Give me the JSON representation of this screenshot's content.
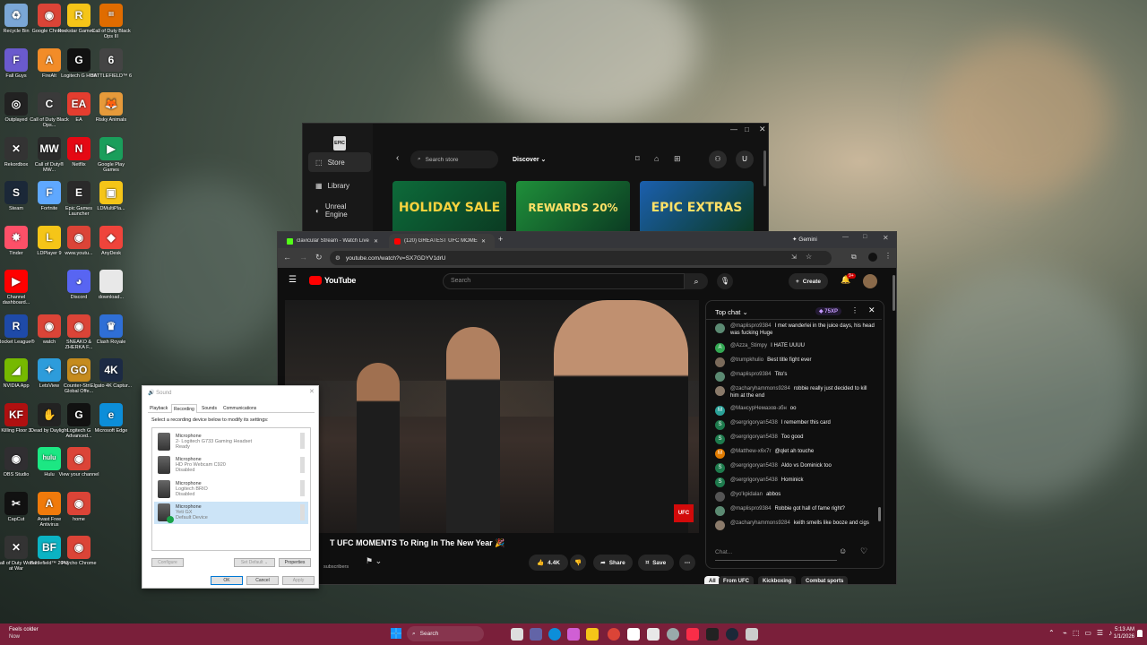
{
  "desktop_icons": [
    {
      "label": "Recycle Bin",
      "color": "#7aa7d6",
      "glyph": "♻"
    },
    {
      "label": "Google Chrome",
      "color": "#db4437",
      "glyph": "◉"
    },
    {
      "label": "Rockstar Games ...",
      "color": "#f5c518",
      "glyph": "R"
    },
    {
      "label": "Call of Duty Black Ops III",
      "color": "#e06c00",
      "glyph": "III"
    },
    {
      "label": "Fall Guys",
      "color": "#6a5acd",
      "glyph": "F"
    },
    {
      "label": "FireAlt",
      "color": "#f28c28",
      "glyph": "A"
    },
    {
      "label": "Logitech G HUB",
      "color": "#111111",
      "glyph": "G"
    },
    {
      "label": "BATTLEFIELD™ 6",
      "color": "#444444",
      "glyph": "6"
    },
    {
      "label": "Outplayed",
      "color": "#222222",
      "glyph": "◎"
    },
    {
      "label": "Call of Duty Black Ops...",
      "color": "#3a3a3a",
      "glyph": "C"
    },
    {
      "label": "EA",
      "color": "#e43d2f",
      "glyph": "EA"
    },
    {
      "label": "Risky Animals",
      "color": "#e69a3a",
      "glyph": "🦊"
    },
    {
      "label": "Rekordbox",
      "color": "#333333",
      "glyph": "✕"
    },
    {
      "label": "Call of Duty® MW...",
      "color": "#2a2a2a",
      "glyph": "MW"
    },
    {
      "label": "Netflix",
      "color": "#e50914",
      "glyph": "N"
    },
    {
      "label": "Google Play Games",
      "color": "#1a9e5b",
      "glyph": "▶"
    },
    {
      "label": "Steam",
      "color": "#1b2838",
      "glyph": "S"
    },
    {
      "label": "Fortnite",
      "color": "#5fa8ff",
      "glyph": "F"
    },
    {
      "label": "Epic Games Launcher",
      "color": "#2a2a2a",
      "glyph": "E"
    },
    {
      "label": "LDMultiPla...",
      "color": "#f5c518",
      "glyph": "▣"
    },
    {
      "label": "Tinder",
      "color": "#fd5068",
      "glyph": "✸"
    },
    {
      "label": "LDPlayer 9",
      "color": "#f5c518",
      "glyph": "L"
    },
    {
      "label": "www.youtu...",
      "color": "#db4437",
      "glyph": "◉"
    },
    {
      "label": "AnyDesk",
      "color": "#ef443b",
      "glyph": "◆"
    },
    {
      "label": "Channel dashboard...",
      "color": "#ff0000",
      "glyph": "▶"
    },
    {
      "label": "",
      "color": "transparent",
      "glyph": ""
    },
    {
      "label": "Discord",
      "color": "#5865f2",
      "glyph": "◕"
    },
    {
      "label": "download...",
      "color": "#e8e8e8",
      "glyph": ""
    },
    {
      "label": "Rocket League®",
      "color": "#1e4aa8",
      "glyph": "R"
    },
    {
      "label": "watch",
      "color": "#db4437",
      "glyph": "◉"
    },
    {
      "label": "SNEAKO & ZHERKA F...",
      "color": "#db4437",
      "glyph": "◉"
    },
    {
      "label": "Clash Royale",
      "color": "#2f6fd6",
      "glyph": "♛"
    },
    {
      "label": "NVIDIA App",
      "color": "#76b900",
      "glyph": "◢"
    },
    {
      "label": "LetsView",
      "color": "#2d9cdb",
      "glyph": "✦"
    },
    {
      "label": "Counter-Stri... Global Offe...",
      "color": "#c58b1e",
      "glyph": "GO"
    },
    {
      "label": "Elgato 4K Captur...",
      "color": "#1c2a44",
      "glyph": "4K"
    },
    {
      "label": "Killing Floor 3",
      "color": "#b01010",
      "glyph": "KF"
    },
    {
      "label": "Dead by Daylight",
      "color": "#222222",
      "glyph": "✋"
    },
    {
      "label": "Logitech G Advanced...",
      "color": "#111111",
      "glyph": "G"
    },
    {
      "label": "Microsoft Edge",
      "color": "#0c8ed9",
      "glyph": "e"
    },
    {
      "label": "OBS Studio",
      "color": "#302e31",
      "glyph": "◉"
    },
    {
      "label": "Hulu",
      "color": "#1ce783",
      "glyph": "hulu"
    },
    {
      "label": "View your channel",
      "color": "#db4437",
      "glyph": "◉"
    },
    {
      "label": "",
      "color": "transparent",
      "glyph": ""
    },
    {
      "label": "CapCut",
      "color": "#111111",
      "glyph": "✂"
    },
    {
      "label": "Avast Free Antivirus",
      "color": "#f07a0b",
      "glyph": "A"
    },
    {
      "label": "home",
      "color": "#db4437",
      "glyph": "◉"
    },
    {
      "label": "",
      "color": "transparent",
      "glyph": ""
    },
    {
      "label": "Call of Duty World at War",
      "color": "#333333",
      "glyph": "✕"
    },
    {
      "label": "Battlefield™ 2042",
      "color": "#0bb3c4",
      "glyph": "BF"
    },
    {
      "label": "Psycho Chrome",
      "color": "#db4437",
      "glyph": "◉"
    },
    {
      "label": "",
      "color": "transparent",
      "glyph": ""
    }
  ],
  "epic": {
    "nav": [
      {
        "label": "Store",
        "icon": "tag-icon"
      },
      {
        "label": "Library",
        "icon": "grid-icon"
      },
      {
        "label": "Unreal Engine",
        "icon": "unreal-icon"
      }
    ],
    "search_placeholder": "Search store",
    "discover": "Discover",
    "avatar_letter": "U",
    "promos": [
      {
        "title": "HOLIDAY SALE",
        "bg": "#0d6b3a",
        "fg": "#f7d23e"
      },
      {
        "title": "REWARDS 20%",
        "bg": "#1f8f3a",
        "fg": "#ffe066"
      },
      {
        "title": "EPIC EXTRAS",
        "bg": "#1b5fae",
        "fg": "#ffe066"
      }
    ]
  },
  "chrome": {
    "tabs": [
      {
        "title": "clavicular Stream - Watch Live",
        "favicon": "#53fc18"
      },
      {
        "title": "(120) GREATEST UFC MOMENT...",
        "favicon": "#ff0000"
      }
    ],
    "gemini_label": "Gemini",
    "url": "youtube.com/watch?v=SX7GDYV1drU"
  },
  "youtube": {
    "logo": "YouTube",
    "search_placeholder": "Search",
    "create_label": "Create",
    "notif_badge": "9+",
    "video_title": "T UFC MOMENTS To Ring In The New Year 🎉",
    "subscribers": "subscribers",
    "like_count": "4.4K",
    "share_label": "Share",
    "save_label": "Save",
    "ufc_badge": "UFC",
    "chips": [
      "All",
      "From UFC",
      "Kickboxing",
      "Combat sports"
    ],
    "chat": {
      "header": "Top chat",
      "xp": "75XP",
      "placeholder": "Chat...",
      "messages": [
        {
          "author": "@maplispro9384",
          "text": "I met wanderlei in the juice days, his head was fucking Huge",
          "color": "#5b8a72",
          "letter": ""
        },
        {
          "author": "@Azza_Stimpy",
          "text": "I HATE UUUU",
          "color": "#33a853",
          "letter": "A"
        },
        {
          "author": "@trumpkhulio",
          "text": "Best title fight ever",
          "color": "#7a6a5a",
          "letter": ""
        },
        {
          "author": "@maplispro9384",
          "text": "Tito's",
          "color": "#5b8a72",
          "letter": ""
        },
        {
          "author": "@zacharyhammons9284",
          "text": "robbie really just decided to kill him at the end",
          "color": "#8a7a6a",
          "letter": ""
        },
        {
          "author": "@МансурНемазов-збн",
          "text": "oo",
          "color": "#2aa198",
          "letter": "М"
        },
        {
          "author": "@sergrigoryan5438",
          "text": "I remember this card",
          "color": "#1e7b4d",
          "letter": "S"
        },
        {
          "author": "@sergrigoryan5438",
          "text": "Too good",
          "color": "#1e7b4d",
          "letter": "S"
        },
        {
          "author": "@Matthew-x6x7r",
          "text": "@qlet ah touche",
          "color": "#e07b00",
          "letter": "M"
        },
        {
          "author": "@sergrigoryan5438",
          "text": "Aldo vs Dominick too",
          "color": "#1e7b4d",
          "letter": "S"
        },
        {
          "author": "@sergrigoryan5438",
          "text": "Hominick",
          "color": "#1e7b4d",
          "letter": "S"
        },
        {
          "author": "@yo'kpidalan",
          "text": "abbos",
          "color": "#555555",
          "letter": ""
        },
        {
          "author": "@maplispro9384",
          "text": "Robbie got hall of fame right?",
          "color": "#5b8a72",
          "letter": ""
        },
        {
          "author": "@zacharyhammons9284",
          "text": "keith smells like booze and cigs",
          "color": "#8a7a6a",
          "letter": ""
        }
      ]
    }
  },
  "sound": {
    "title": "Sound",
    "tabs": [
      "Playback",
      "Recording",
      "Sounds",
      "Communications"
    ],
    "instruction": "Select a recording device below to modify its settings:",
    "devices": [
      {
        "name": "Microphone",
        "detail": "2- Logitech G733 Gaming Headset",
        "status": "Ready"
      },
      {
        "name": "Microphone",
        "detail": "HD Pro Webcam C920",
        "status": "Disabled"
      },
      {
        "name": "Microphone",
        "detail": "Logitech BRIO",
        "status": "Disabled"
      },
      {
        "name": "Microphone",
        "detail": "Yeti GX",
        "status": "Default Device"
      }
    ],
    "configure": "Configure",
    "set_default": "Set Default",
    "properties": "Properties",
    "ok": "OK",
    "cancel": "Cancel",
    "apply": "Apply"
  },
  "taskbar": {
    "weather_title": "Feels colder",
    "weather_sub": "Now",
    "search": "Search",
    "time": "5:13 AM",
    "date": "1/1/2026"
  }
}
